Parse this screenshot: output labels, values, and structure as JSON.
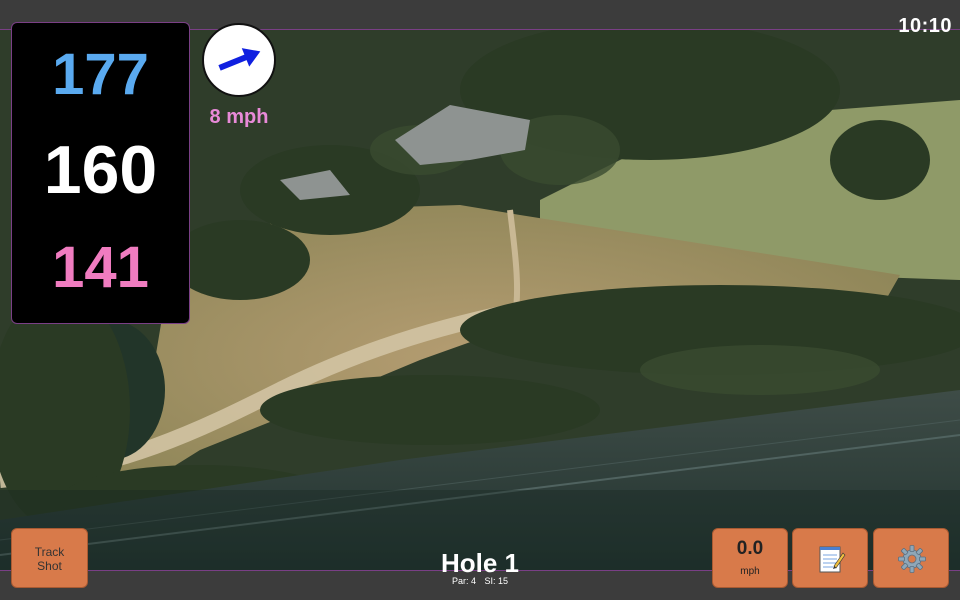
{
  "clock": {
    "time": "10:10"
  },
  "distances": {
    "back": "177",
    "center": "160",
    "front": "141"
  },
  "wind": {
    "speed": "8 mph",
    "direction_icon": "arrow-right-up-icon"
  },
  "hole": {
    "title": "Hole 1",
    "par": "Par: 4",
    "stroke_index": "SI: 15"
  },
  "buttons": {
    "track_shot_line1": "Track",
    "track_shot_line2": "Shot",
    "speed_value": "0.0",
    "speed_unit": "mph",
    "notes_icon": "notepad-icon",
    "settings_icon": "gear-icon"
  },
  "colors": {
    "back_distance": "#5aaaf0",
    "center_distance": "#ffffff",
    "front_distance": "#f07cc0",
    "wind_text": "#e88ad8",
    "button_bg": "#d87a4a",
    "accent_border": "#7a3f86"
  }
}
